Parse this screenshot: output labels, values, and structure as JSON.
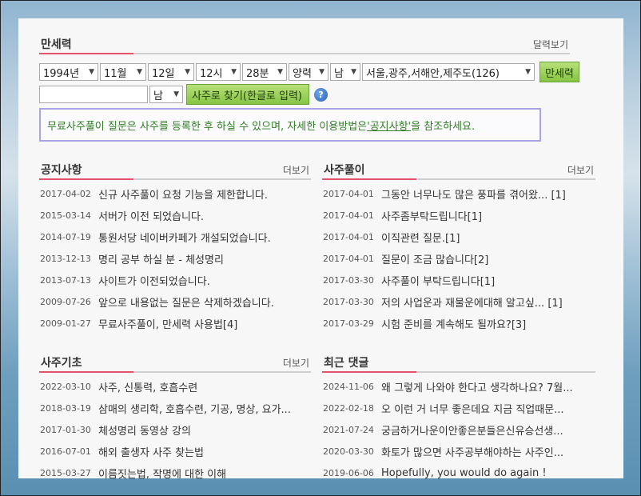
{
  "manse": {
    "title": "만세력",
    "more": "달력보기",
    "selects": {
      "year": "1994년",
      "month": "11월",
      "day": "12일",
      "hour": "12시",
      "minute": "28분",
      "calendar": "양력",
      "gender": "남",
      "region": "서울,광주,서해안,제주도(126)"
    },
    "go_button": "만세력",
    "search": {
      "name_value": "",
      "gender": "남",
      "button": "사주로 찾기(한글로 입력)",
      "help": "?"
    },
    "notice_prefix": "무료사주풀이 질문은 사주를 등록한 후 하실 수 있으며, 자세한 이용방법은 ",
    "notice_link": "'공지사항'",
    "notice_suffix": "을 참조하세요."
  },
  "notices": {
    "title": "공지사항",
    "more": "더보기",
    "items": [
      {
        "date": "2017-04-02",
        "text": "신규 사주풀이 요청 기능을 제한합니다."
      },
      {
        "date": "2015-03-14",
        "text": "서버가 이전 되었습니다."
      },
      {
        "date": "2014-07-19",
        "text": "통원서당 네이버카페가 개설되었습니다."
      },
      {
        "date": "2013-12-13",
        "text": "명리 공부 하실 분 - 체성명리"
      },
      {
        "date": "2013-07-13",
        "text": "사이트가 이전되었습니다."
      },
      {
        "date": "2009-07-26",
        "text": "앞으로 내용없는 질문은 삭제하겠습니다."
      },
      {
        "date": "2009-01-27",
        "text": "무료사주풀이, 만세력 사용법[4]"
      }
    ]
  },
  "saju": {
    "title": "사주풀이",
    "more": "더보기",
    "items": [
      {
        "date": "2017-04-01",
        "text": "그동안 너무나도 많은 풍파를 겪어왔... [1]"
      },
      {
        "date": "2017-04-01",
        "text": "사주좀부탁드립니다[1]"
      },
      {
        "date": "2017-04-01",
        "text": "이직관련 질문.[1]"
      },
      {
        "date": "2017-04-01",
        "text": "질문이 조금 많습니다[2]"
      },
      {
        "date": "2017-03-30",
        "text": "사주풀이 부탁드립니다[1]"
      },
      {
        "date": "2017-03-30",
        "text": "저의 사업운과 재물운에대해 알고싶...  [1]"
      },
      {
        "date": "2017-03-29",
        "text": "시험 준비를 계속해도 될까요?[3]"
      }
    ]
  },
  "basics": {
    "title": "사주기초",
    "more": "더보기",
    "items": [
      {
        "date": "2022-03-10",
        "text": "사주, 신통력, 호흡수련"
      },
      {
        "date": "2018-03-19",
        "text": "삼매의 생리학, 호흡수련, 기공, 명상, 요가..."
      },
      {
        "date": "2017-01-30",
        "text": "체성명리 동영상 강의"
      },
      {
        "date": "2016-07-01",
        "text": "해외 출생자 사주 찾는법"
      },
      {
        "date": "2015-03-27",
        "text": "이름짓는법, 작명에 대한 이해"
      }
    ]
  },
  "comments": {
    "title": "최근 댓글",
    "items": [
      {
        "date": "2024-11-06",
        "text": "왜 그렇게 나와야 한다고 생각하나요? 7월..."
      },
      {
        "date": "2022-02-18",
        "text": "오 이런 거 너무 좋은데요 지금 직업때문..."
      },
      {
        "date": "2021-07-24",
        "text": "궁금하거나운이안좋은분들은신유승선생..."
      },
      {
        "date": "2020-03-30",
        "text": "화토가 많으면 사주공부해야하는 사주인..."
      },
      {
        "date": "2019-06-06",
        "text": "Hopefully, you would do again !"
      }
    ]
  },
  "colors": {
    "accent": "#e3546c",
    "notice_text": "#2f7d22",
    "notice_border": "#a9a4e6",
    "button_green": "#86c544"
  }
}
